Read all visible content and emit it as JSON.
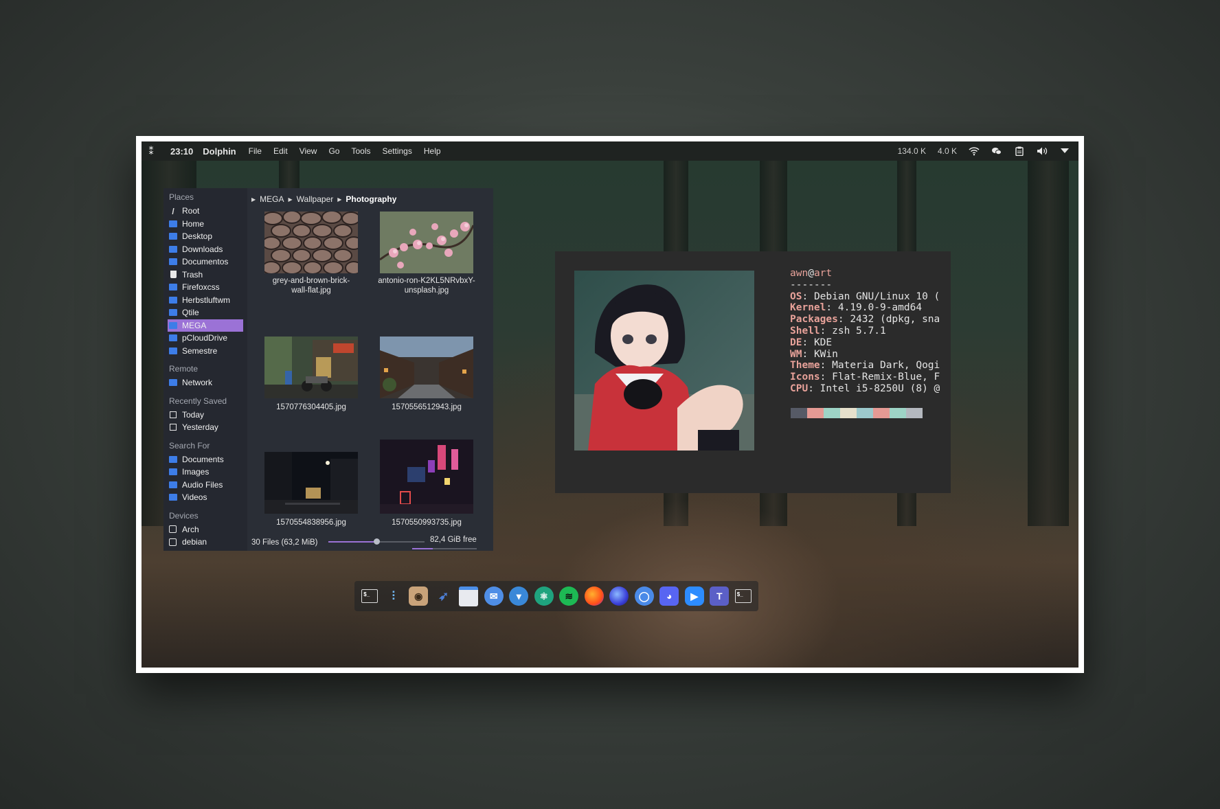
{
  "topbar": {
    "clock": "23:10",
    "app_name": "Dolphin",
    "menu": [
      "File",
      "Edit",
      "View",
      "Go",
      "Tools",
      "Settings",
      "Help"
    ],
    "net_down": "134.0 K",
    "net_up": "4.0 K",
    "tray_icons": [
      "wifi-icon",
      "chat-icon",
      "clipboard-icon",
      "volume-icon",
      "tray-expand-icon"
    ]
  },
  "dolphin": {
    "sections": {
      "places": "Places",
      "remote": "Remote",
      "recent": "Recently Saved",
      "search": "Search For",
      "devices": "Devices"
    },
    "places": [
      "Root",
      "Home",
      "Desktop",
      "Downloads",
      "Documentos",
      "Trash",
      "Firefoxcss",
      "Herbstluftwm",
      "Qtile",
      "MEGA",
      "pCloudDrive",
      "Semestre"
    ],
    "remote": [
      "Network"
    ],
    "recent": [
      "Today",
      "Yesterday"
    ],
    "search": [
      "Documents",
      "Images",
      "Audio Files",
      "Videos"
    ],
    "devices": [
      "Arch",
      "debian"
    ],
    "breadcrumb": [
      "MEGA",
      "Wallpaper",
      "Photography"
    ],
    "files": [
      {
        "line1": "grey-and-brown-brick-",
        "line2": "wall-flat.jpg"
      },
      {
        "line1": "antonio-ron-K2KL5NRvbxY-",
        "line2": "unsplash.jpg"
      },
      {
        "line1": "1570776304405.jpg",
        "line2": ""
      },
      {
        "line1": "1570556512943.jpg",
        "line2": ""
      },
      {
        "line1": "1570554838956.jpg",
        "line2": ""
      },
      {
        "line1": "1570550993735.jpg",
        "line2": ""
      }
    ],
    "status_files": "30 Files (63,2 MiB)",
    "zoom_fraction": 0.5,
    "free_space": "82,4 GiB free"
  },
  "neofetch": {
    "user": "awn",
    "host": "art",
    "separator": "-------",
    "os_key": "OS",
    "os_val": "Debian GNU/Linux 10 (",
    "kernel_key": "Kernel",
    "kernel_val": "4.19.0-9-amd64",
    "packages_key": "Packages",
    "packages_val": "2432 (dpkg, sna",
    "shell_key": "Shell",
    "shell_val": "zsh 5.7.1",
    "de_key": "DE",
    "de_val": "KDE",
    "wm_key": "WM",
    "wm_val": "KWin",
    "theme_key": "Theme",
    "theme_val": "Materia Dark, Qogi",
    "icons_key": "Icons",
    "icons_val": "Flat-Remix-Blue, F",
    "cpu_key": "CPU",
    "cpu_val": "Intel i5-8250U (8) @",
    "palette": [
      "#565a66",
      "#e59a94",
      "#9ed4c6",
      "#e6e0cc",
      "#9cc9cc",
      "#e59a94",
      "#9ed4c6",
      "#b4b8bf"
    ]
  },
  "dock": [
    "terminal-icon",
    "mixer-icon",
    "camera-app-icon",
    "swordfish-icon",
    "files-icon",
    "mail-icon",
    "vpn-icon",
    "atom-icon",
    "spotify-icon",
    "firefox-icon",
    "firefox-nightly-icon",
    "chromium-icon",
    "discord-icon",
    "zoom-icon",
    "teams-icon",
    "terminal-icon"
  ]
}
